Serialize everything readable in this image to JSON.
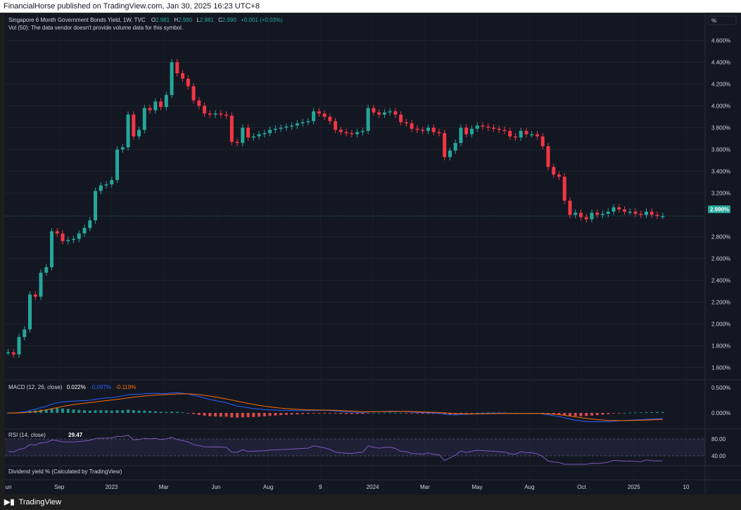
{
  "header": {
    "publisher": "FinancialHorse published on TradingView.com, Jan 30, 2025 16:23 UTC+8"
  },
  "legend": {
    "symbol": "Singapore 6 Month Government Bonds Yield, 1W, TVC",
    "o_label": "O",
    "o_value": "2.981",
    "h_label": "H",
    "h_value": "2.990",
    "l_label": "L",
    "l_value": "2.981",
    "c_label": "C",
    "c_value": "2.990",
    "change": "+0.001 (+0.03%)",
    "vol_note": "Vol (50): The data vendor doesn't provide volume data for this symbol."
  },
  "scale_button": "%",
  "last_price_label": "2.990%",
  "macd": {
    "label": "MACD (12, 26, close)",
    "hist": "0.022%",
    "macd": "-0.097%",
    "signal": "-0.119%"
  },
  "rsi": {
    "label": "RSI (14, close)",
    "value": "29.47"
  },
  "dividend": {
    "label": "Dividend yield % (Calculated by TradingView)"
  },
  "footer": {
    "brand": "TradingView"
  },
  "colors": {
    "up": "#26a69a",
    "down": "#f23645",
    "bg": "#131722",
    "macd": "#2962ff",
    "signal": "#ff6d00",
    "rsi": "#7e57c2"
  },
  "chart_data": {
    "type": "candlestick",
    "title": "Singapore 6 Month Government Bonds Yield, 1W, TVC",
    "unit": "%",
    "ylim": [
      1.5,
      4.7
    ],
    "y_ticks": [
      "4.600%",
      "4.400%",
      "4.200%",
      "4.000%",
      "3.800%",
      "3.600%",
      "3.400%",
      "3.200%",
      "2.800%",
      "2.600%",
      "2.400%",
      "2.200%",
      "2.000%",
      "1.800%",
      "1.600%"
    ],
    "x_ticks": [
      "Jun",
      "Sep",
      "2023",
      "Mar",
      "Jun",
      "Aug",
      "9",
      "2024",
      "Mar",
      "May",
      "Aug",
      "Oct",
      "2025",
      "10"
    ],
    "closes": [
      1.74,
      1.72,
      1.88,
      1.95,
      2.27,
      2.25,
      2.47,
      2.52,
      2.85,
      2.83,
      2.76,
      2.77,
      2.78,
      2.83,
      2.88,
      2.95,
      3.22,
      3.27,
      3.28,
      3.32,
      3.6,
      3.62,
      3.92,
      3.72,
      3.78,
      3.98,
      3.96,
      4.04,
      3.99,
      4.1,
      4.4,
      4.3,
      4.25,
      4.18,
      4.05,
      4.0,
      3.93,
      3.92,
      3.93,
      3.92,
      3.91,
      3.67,
      3.66,
      3.8,
      3.71,
      3.72,
      3.74,
      3.75,
      3.78,
      3.79,
      3.8,
      3.81,
      3.82,
      3.84,
      3.85,
      3.86,
      3.95,
      3.93,
      3.9,
      3.86,
      3.78,
      3.76,
      3.75,
      3.74,
      3.76,
      3.77,
      3.98,
      3.94,
      3.92,
      3.94,
      3.95,
      3.92,
      3.85,
      3.84,
      3.79,
      3.78,
      3.77,
      3.8,
      3.76,
      3.75,
      3.53,
      3.59,
      3.66,
      3.8,
      3.74,
      3.79,
      3.82,
      3.81,
      3.8,
      3.79,
      3.78,
      3.77,
      3.72,
      3.71,
      3.77,
      3.74,
      3.74,
      3.72,
      3.63,
      3.44,
      3.37,
      3.35,
      3.13,
      3.0,
      3.02,
      2.98,
      2.96,
      3.02,
      3.0,
      3.01,
      3.03,
      3.07,
      3.05,
      3.03,
      3.03,
      3.01,
      3.0,
      3.03,
      3.0,
      2.99,
      2.99
    ],
    "opens": [
      1.74,
      1.74,
      1.72,
      1.88,
      1.95,
      2.27,
      2.25,
      2.47,
      2.52,
      2.85,
      2.83,
      2.76,
      2.77,
      2.78,
      2.83,
      2.88,
      2.95,
      3.22,
      3.27,
      3.28,
      3.32,
      3.6,
      3.62,
      3.92,
      3.72,
      3.78,
      3.98,
      3.96,
      4.04,
      3.99,
      4.1,
      4.4,
      4.3,
      4.25,
      4.18,
      4.05,
      4.0,
      3.93,
      3.92,
      3.93,
      3.92,
      3.91,
      3.67,
      3.66,
      3.8,
      3.71,
      3.72,
      3.74,
      3.75,
      3.78,
      3.79,
      3.8,
      3.81,
      3.82,
      3.84,
      3.85,
      3.86,
      3.95,
      3.93,
      3.9,
      3.86,
      3.78,
      3.76,
      3.75,
      3.74,
      3.76,
      3.77,
      3.98,
      3.94,
      3.92,
      3.94,
      3.95,
      3.92,
      3.85,
      3.84,
      3.79,
      3.78,
      3.77,
      3.8,
      3.76,
      3.75,
      3.53,
      3.59,
      3.66,
      3.8,
      3.74,
      3.79,
      3.82,
      3.81,
      3.8,
      3.79,
      3.78,
      3.77,
      3.72,
      3.71,
      3.77,
      3.74,
      3.74,
      3.72,
      3.63,
      3.44,
      3.37,
      3.35,
      3.13,
      3.0,
      3.02,
      2.98,
      2.96,
      3.02,
      3.0,
      3.01,
      3.03,
      3.07,
      3.05,
      3.03,
      3.03,
      3.01,
      3.0,
      3.03,
      3.0,
      2.99
    ],
    "rsi_range": [
      20,
      100
    ],
    "rsi_levels": [
      80,
      40
    ]
  }
}
